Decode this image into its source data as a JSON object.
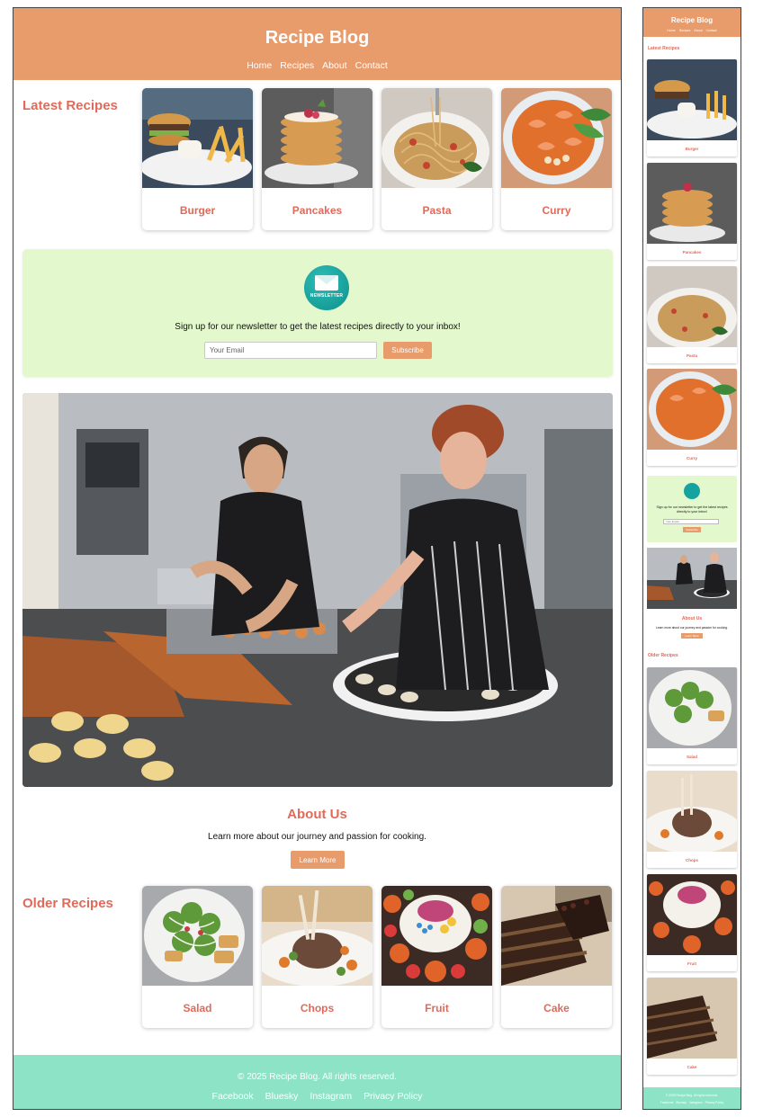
{
  "site": {
    "title": "Recipe Blog"
  },
  "nav": [
    "Home",
    "Recipes",
    "About",
    "Contact"
  ],
  "latest": {
    "title": "Latest Recipes",
    "items": [
      {
        "label": "Burger",
        "image": "burger-with-fries-photo"
      },
      {
        "label": "Pancakes",
        "image": "pancake-stack-photo"
      },
      {
        "label": "Pasta",
        "image": "spaghetti-fork-photo"
      },
      {
        "label": "Curry",
        "image": "shrimp-curry-photo"
      }
    ]
  },
  "newsletter": {
    "icon": "newsletter-envelope-icon",
    "icon_text": "NEWSLETTER",
    "text": "Sign up for our newsletter to get the latest recipes directly to your inbox!",
    "placeholder": "Your Email",
    "button": "Subscribe"
  },
  "hero": {
    "image": "chefs-plating-in-kitchen-photo"
  },
  "about": {
    "title": "About Us",
    "text": "Learn more about our journey and passion for cooking.",
    "button": "Learn More"
  },
  "older": {
    "title": "Older Recipes",
    "items": [
      {
        "label": "Salad",
        "image": "salad-plate-photo"
      },
      {
        "label": "Chops",
        "image": "lamb-chops-photo"
      },
      {
        "label": "Fruit",
        "image": "fruit-bowl-photo"
      },
      {
        "label": "Cake",
        "image": "chocolate-cake-slice-photo"
      }
    ]
  },
  "footer": {
    "copyright": "© 2025 Recipe Blog. All rights reserved.",
    "links": [
      "Facebook",
      "Bluesky",
      "Instagram",
      "Privacy Policy"
    ]
  },
  "colors": {
    "header": "#e89c6c",
    "accent_text": "#e06a5a",
    "newsletter_bg": "#e3f8cc",
    "footer": "#8de3c5"
  }
}
